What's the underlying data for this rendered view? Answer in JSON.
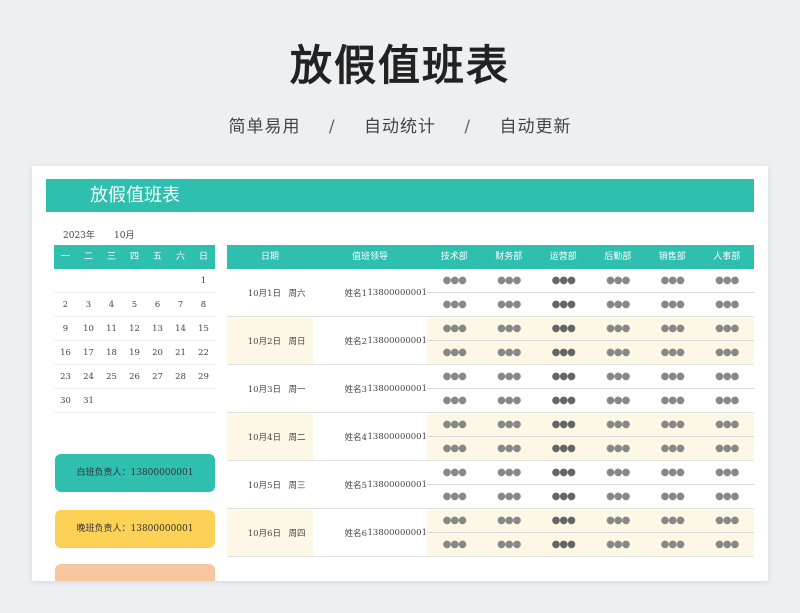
{
  "page": {
    "title": "放假值班表",
    "features": [
      "简单易用",
      "自动统计",
      "自动更新"
    ],
    "separator": "/"
  },
  "sheet": {
    "title": "放假值班表",
    "year": "2023年",
    "month": "10月",
    "calendar": {
      "weekdays": [
        "一",
        "二",
        "三",
        "四",
        "五",
        "六",
        "日"
      ],
      "weeks": [
        [
          "",
          "",
          "",
          "",
          "",
          "",
          "1"
        ],
        [
          "2",
          "3",
          "4",
          "5",
          "6",
          "7",
          "8"
        ],
        [
          "9",
          "10",
          "11",
          "12",
          "13",
          "14",
          "15"
        ],
        [
          "16",
          "17",
          "18",
          "19",
          "20",
          "21",
          "22"
        ],
        [
          "23",
          "24",
          "25",
          "26",
          "27",
          "28",
          "29"
        ],
        [
          "30",
          "31",
          "",
          "",
          "",
          "",
          ""
        ]
      ]
    },
    "day_shift": "白班负责人：13800000001",
    "night_shift": "晚班负责人：13800000001",
    "table": {
      "headers": {
        "date": "日期",
        "leader": "值班领导",
        "depts": [
          "技术部",
          "财务部",
          "运营部",
          "后勤部",
          "销售部",
          "人事部"
        ]
      },
      "placeholder": "●●●",
      "rows": [
        {
          "date": "10月1日",
          "weekday": "周六",
          "name": "姓名1",
          "phone": "13800000001"
        },
        {
          "date": "10月2日",
          "weekday": "周日",
          "name": "姓名2",
          "phone": "13800000001"
        },
        {
          "date": "10月3日",
          "weekday": "周一",
          "name": "姓名3",
          "phone": "13800000001"
        },
        {
          "date": "10月4日",
          "weekday": "周二",
          "name": "姓名4",
          "phone": "13800000001"
        },
        {
          "date": "10月5日",
          "weekday": "周三",
          "name": "姓名5",
          "phone": "13800000001"
        },
        {
          "date": "10月6日",
          "weekday": "周四",
          "name": "姓名6",
          "phone": "13800000001"
        }
      ]
    }
  },
  "colors": {
    "accent": "#2fbfae",
    "shade": "#fdf8e6",
    "night": "#fcd256"
  }
}
